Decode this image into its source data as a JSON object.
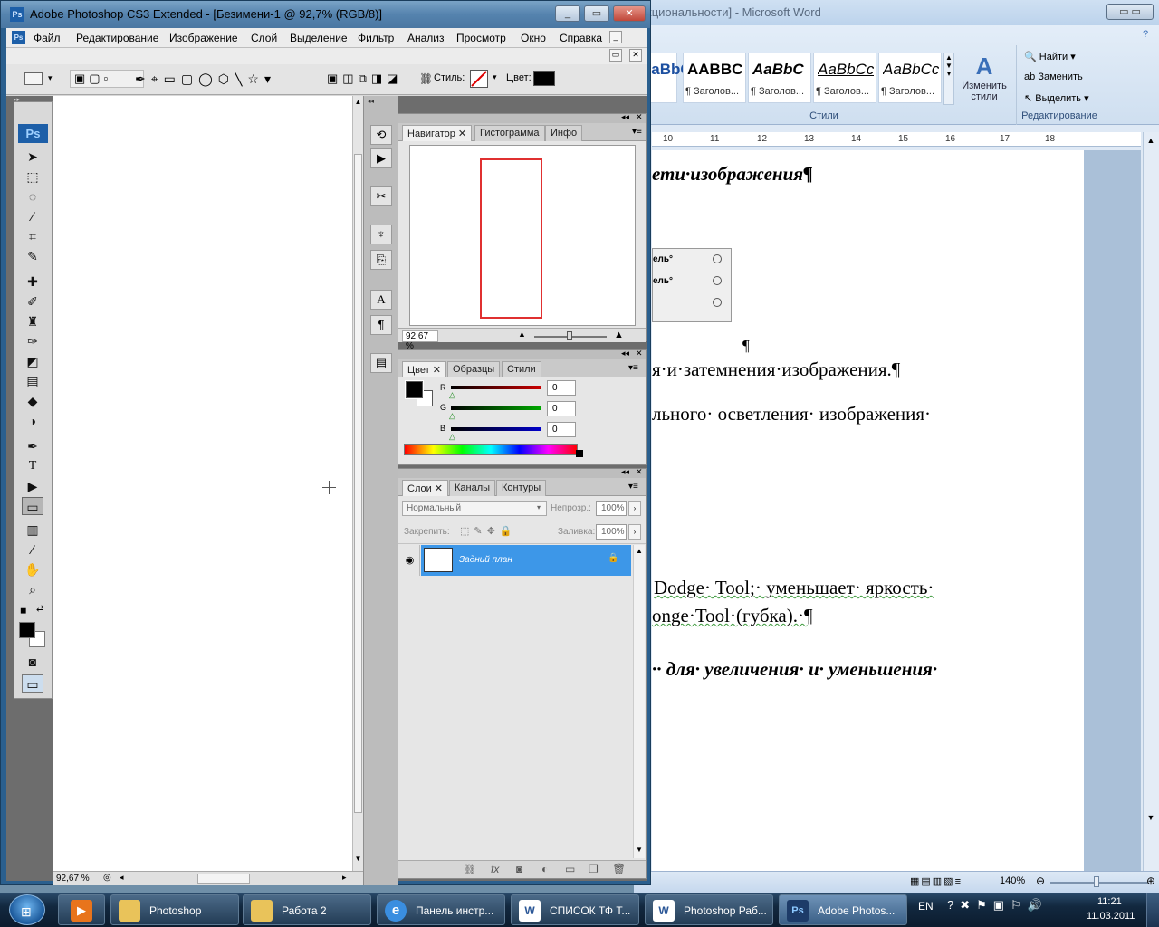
{
  "word": {
    "title": "кционально­сти] - Microsoft Word",
    "styles": [
      {
        "sample": "AaBbCc",
        "caption": "сы"
      },
      {
        "sample": "AABBC",
        "caption": "¶ Заголов..."
      },
      {
        "sample": "AaBbC",
        "caption": "¶ Заголов..."
      },
      {
        "sample": "AaBbCc",
        "caption": "¶ Заголов..."
      },
      {
        "sample": "AaBbCc",
        "caption": "¶ Заголов..."
      }
    ],
    "change_styles_label": "Изменить стили",
    "styles_group_label": "Стили",
    "find_label": "Найти",
    "replace_label": "Заменить",
    "select_label": "Выделить",
    "editing_group_label": "Редактирование",
    "ruler_numbers": [
      "10",
      "11",
      "12",
      "13",
      "14",
      "15",
      "16",
      "17",
      "18"
    ],
    "doc": {
      "heading": "ети·изображения¶",
      "list_items": [
        "ель°",
        "ель°"
      ],
      "para_mark": "¶",
      "line1": "я·и·затемнения·изображения.¶",
      "line2": "льного· осветления· изображения·",
      "line3": "Dodge· Tool;· уменьшает· яркость·",
      "line4": "onge·Tool·(губка).·¶",
      "line5": "·· для· увеличения· и· уменьшения·"
    },
    "zoom": "140%"
  },
  "photoshop": {
    "title": "Adobe Photoshop CS3 Extended - [Безимени-1 @ 92,7% (RGB/8)]",
    "menu": [
      "Файл",
      "Редактирование",
      "Изображение",
      "Слой",
      "Выделение",
      "Фильтр",
      "Анализ",
      "Просмотр",
      "Окно",
      "Справка"
    ],
    "options": {
      "style_label": "Стиль:",
      "color_label": "Цвет:",
      "color_value": "#000000"
    },
    "doc_zoom": "92,67 %",
    "navigator": {
      "tabs": [
        "Навигатор",
        "Гистограмма",
        "Инфо"
      ],
      "zoom": "92.67 %"
    },
    "color_panel": {
      "tabs": [
        "Цвет",
        "Образцы",
        "Стили"
      ],
      "channels": [
        {
          "label": "R",
          "value": "0",
          "color": "#cc0000"
        },
        {
          "label": "G",
          "value": "0",
          "color": "#00aa00"
        },
        {
          "label": "B",
          "value": "0",
          "color": "#0000cc"
        }
      ]
    },
    "layers_panel": {
      "tabs": [
        "Слои",
        "Каналы",
        "Контуры"
      ],
      "blend_mode": "Нормальный",
      "opacity_label": "Непрозр.:",
      "opacity_value": "100%",
      "lock_label": "Закрепить:",
      "fill_label": "Заливка:",
      "fill_value": "100%",
      "layers": [
        {
          "name": "Задний план",
          "selected": true
        }
      ]
    }
  },
  "taskbar": {
    "items": [
      {
        "label": "Photoshop",
        "icon": "folder-icon"
      },
      {
        "label": "Работа 2",
        "icon": "folder-icon"
      },
      {
        "label": "Панель инстр...",
        "icon": "ie-icon"
      },
      {
        "label": "СПИСОК ТФ Т...",
        "icon": "word-icon"
      },
      {
        "label": "Photoshop Раб...",
        "icon": "word-icon"
      },
      {
        "label": "Adobe Photos...",
        "icon": "photoshop-icon"
      }
    ],
    "language": "EN",
    "time": "11:21",
    "date": "11.03.2011"
  },
  "colors": {
    "selection": "#3d97e8",
    "ps_accent": "#1d5fa8",
    "navigator_frame": "#e03030"
  }
}
